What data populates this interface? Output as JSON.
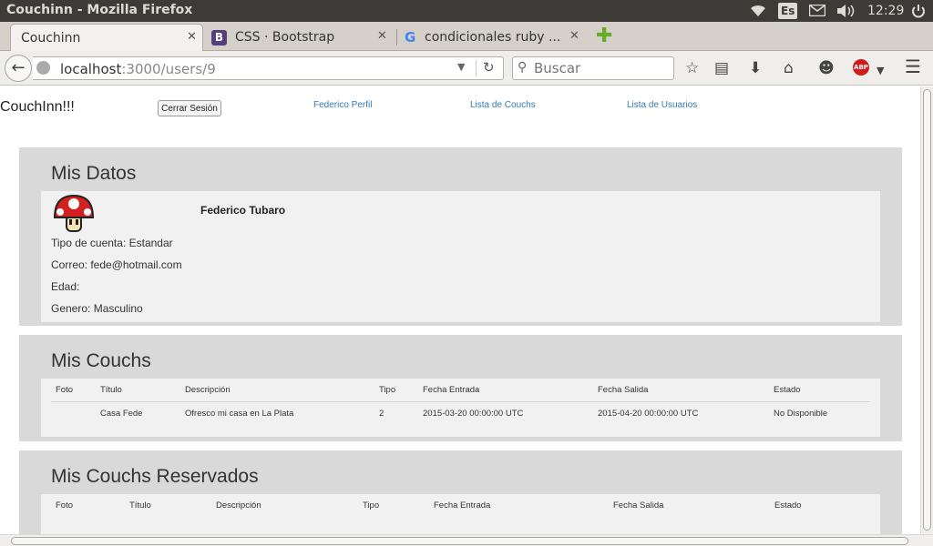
{
  "window": {
    "title": "Couchinn - Mozilla Firefox"
  },
  "tray": {
    "keyboard_layout": "Es",
    "clock": "12:29"
  },
  "tabs": [
    {
      "label": "Couchinn",
      "favicon": "none"
    },
    {
      "label": "CSS · Bootstrap",
      "favicon": "B"
    },
    {
      "label": "condicionales ruby ...",
      "favicon": "G"
    }
  ],
  "navbar": {
    "url_host": "localhost",
    "url_rest": ":3000/users/9",
    "search_placeholder": "Buscar"
  },
  "site_nav": {
    "brand": "CouchInn!!!",
    "logout_label": "Cerrar Sesión",
    "links": [
      "Federico Perfil",
      "Lista de Couchs",
      "Lista de Usuarios"
    ]
  },
  "profile": {
    "heading": "Mis Datos",
    "name": "Federico Tubaro",
    "fields": [
      "Tipo de cuenta: Estandar",
      "Correo: fede@hotmail.com",
      "Edad:",
      "Genero: Masculino"
    ]
  },
  "couchs": {
    "heading": "Mis Couchs",
    "columns": [
      "Foto",
      "Título",
      "Descripción",
      "Tipo",
      "Fecha Entrada",
      "Fecha Salida",
      "Estado"
    ],
    "rows": [
      [
        "",
        "Casa Fede",
        "Ofresco mi casa en La Plata",
        "2",
        "2015-03-20 00:00:00 UTC",
        "2015-04-20 00:00:00 UTC",
        "No Disponible"
      ]
    ]
  },
  "reserved": {
    "heading": "Mis Couchs Reservados",
    "columns": [
      "Foto",
      "Título",
      "Descripción",
      "Tipo",
      "Fecha Entrada",
      "Fecha Salida",
      "Estado"
    ]
  },
  "colors": {
    "link": "#337ab7",
    "well": "#d9d9d9",
    "panel": "#f1f1f1",
    "ubuntu_bar": "#3c3b37"
  }
}
